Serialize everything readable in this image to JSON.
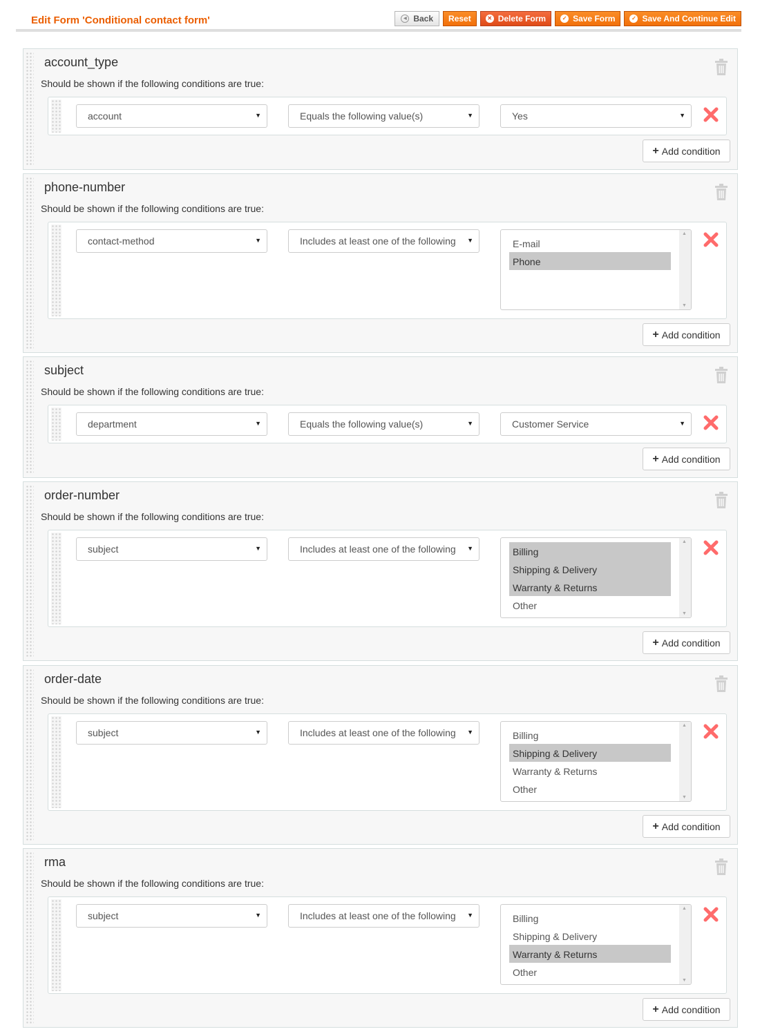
{
  "header": {
    "title": "Edit Form 'Conditional contact form'",
    "buttons": {
      "back": "Back",
      "reset": "Reset",
      "delete": "Delete Form",
      "save": "Save Form",
      "save_continue": "Save And Continue Edit"
    }
  },
  "labels": {
    "condition_intro": "Should be shown if the following conditions are true:",
    "add_condition": "Add condition"
  },
  "colors": {
    "accent": "#eb5e00",
    "remove": "#ff6b6b",
    "selected_option": "#c8c8c8"
  },
  "fields": [
    {
      "name": "account_type",
      "condition": {
        "field": "account",
        "operator": "Equals the following value(s)",
        "value": "Yes"
      }
    },
    {
      "name": "phone-number",
      "condition": {
        "field": "contact-method",
        "operator": "Includes at least one of the following",
        "options": [
          {
            "label": "E-mail",
            "selected": false
          },
          {
            "label": "Phone",
            "selected": true
          }
        ]
      }
    },
    {
      "name": "subject",
      "condition": {
        "field": "department",
        "operator": "Equals the following value(s)",
        "value": "Customer Service"
      }
    },
    {
      "name": "order-number",
      "condition": {
        "field": "subject",
        "operator": "Includes at least one of the following",
        "options": [
          {
            "label": "Billing",
            "selected": true
          },
          {
            "label": "Shipping & Delivery",
            "selected": true
          },
          {
            "label": "Warranty & Returns",
            "selected": true
          },
          {
            "label": "Other",
            "selected": false
          }
        ]
      }
    },
    {
      "name": "order-date",
      "condition": {
        "field": "subject",
        "operator": "Includes at least one of the following",
        "options": [
          {
            "label": "Billing",
            "selected": false
          },
          {
            "label": "Shipping & Delivery",
            "selected": true
          },
          {
            "label": "Warranty & Returns",
            "selected": false
          },
          {
            "label": "Other",
            "selected": false
          }
        ]
      }
    },
    {
      "name": "rma",
      "condition": {
        "field": "subject",
        "operator": "Includes at least one of the following",
        "options": [
          {
            "label": "Billing",
            "selected": false
          },
          {
            "label": "Shipping & Delivery",
            "selected": false
          },
          {
            "label": "Warranty & Returns",
            "selected": true
          },
          {
            "label": "Other",
            "selected": false
          }
        ]
      }
    }
  ]
}
